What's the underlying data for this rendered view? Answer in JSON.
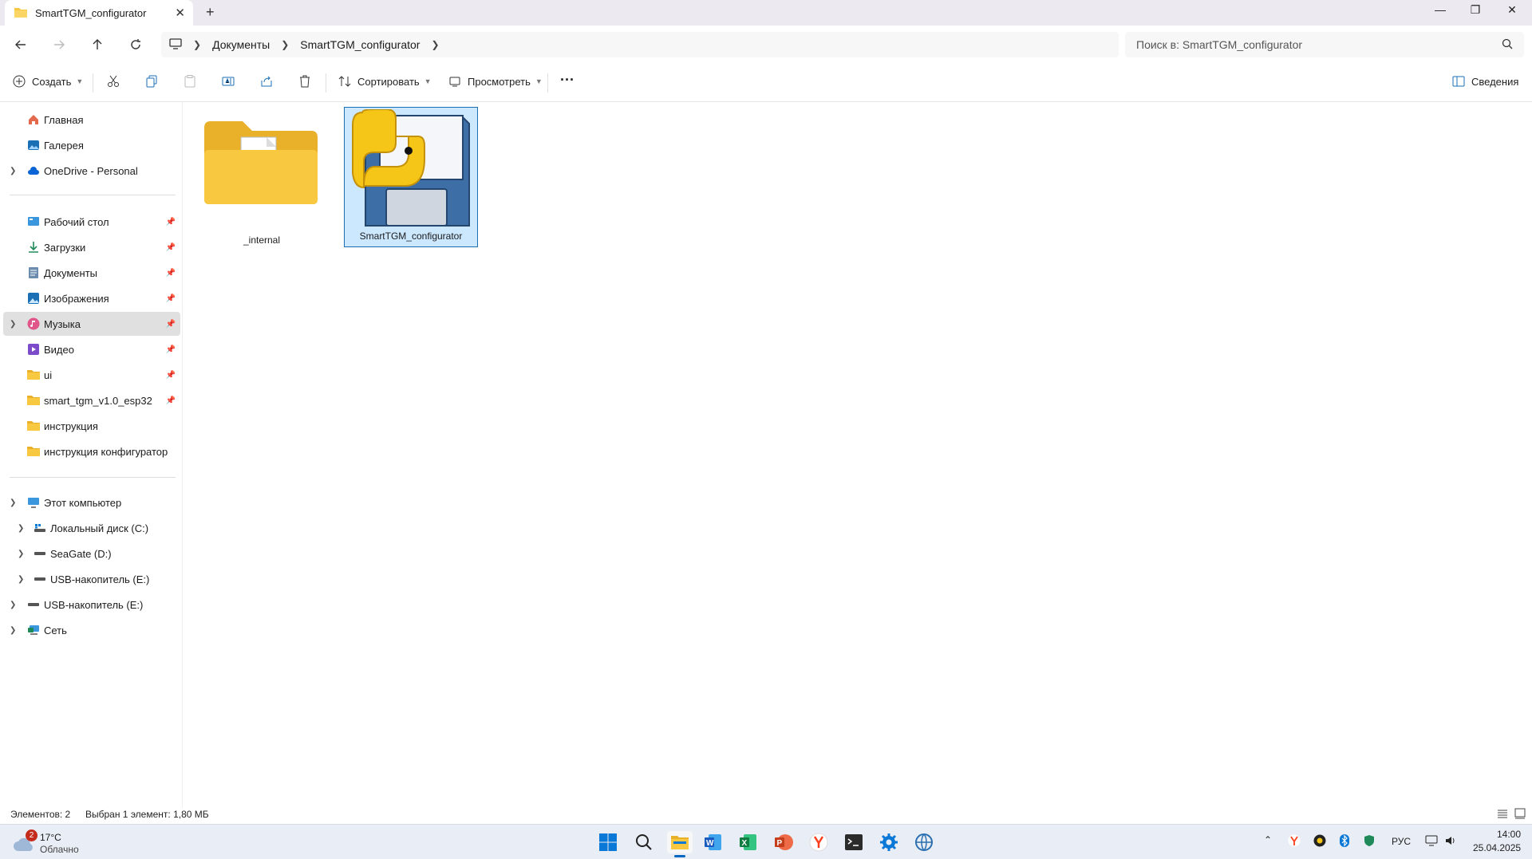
{
  "window": {
    "tab_title": "SmartTGM_configurator",
    "new_tab": "+",
    "minimize": "—",
    "maximize": "❐",
    "close": "✕"
  },
  "address": {
    "crumbs": [
      "Документы",
      "SmartTGM_configurator"
    ],
    "search_placeholder": "Поиск в: SmartTGM_configurator"
  },
  "toolbar": {
    "create": "Создать",
    "sort": "Сортировать",
    "view": "Просмотреть",
    "more": "···",
    "details": "Сведения"
  },
  "sidebar": {
    "top": [
      {
        "label": "Главная",
        "icon": "home-icon"
      },
      {
        "label": "Галерея",
        "icon": "gallery-icon"
      },
      {
        "label": "OneDrive - Personal",
        "icon": "cloud-icon"
      }
    ],
    "quick": [
      {
        "label": "Рабочий стол",
        "icon": "desktop-icon",
        "pinned": true
      },
      {
        "label": "Загрузки",
        "icon": "download-icon",
        "pinned": true
      },
      {
        "label": "Документы",
        "icon": "document-icon",
        "pinned": true
      },
      {
        "label": "Изображения",
        "icon": "pictures-icon",
        "pinned": true
      },
      {
        "label": "Музыка",
        "icon": "music-icon",
        "pinned": true,
        "selected": true
      },
      {
        "label": "Видео",
        "icon": "video-icon",
        "pinned": true
      },
      {
        "label": "ui",
        "icon": "folder-icon",
        "pinned": true
      },
      {
        "label": "smart_tgm_v1.0_esp32",
        "icon": "folder-icon",
        "pinned": true
      },
      {
        "label": "инструкция",
        "icon": "folder-icon",
        "pinned": false
      },
      {
        "label": "инструкция конфигуратор",
        "icon": "folder-icon",
        "pinned": false
      }
    ],
    "pc": [
      {
        "label": "Этот компьютер",
        "icon": "computer-icon"
      },
      {
        "label": "Локальный диск (C:)",
        "icon": "drive-icon"
      },
      {
        "label": "SeaGate (D:)",
        "icon": "drive-icon"
      },
      {
        "label": "USB-накопитель (E:)",
        "icon": "usb-drive-icon"
      },
      {
        "label": "USB-накопитель (E:)",
        "icon": "usb-drive-icon"
      },
      {
        "label": "Сеть",
        "icon": "network-icon"
      }
    ]
  },
  "files": [
    {
      "name": "_internal",
      "type": "folder"
    },
    {
      "name": "SmartTGM_configurator",
      "type": "python-exe",
      "selected": true
    }
  ],
  "status": {
    "count": "Элементов: 2",
    "selection": "Выбран 1 элемент: 1,80 МБ"
  },
  "taskbar": {
    "weather_temp": "17°C",
    "weather_desc": "Облачно",
    "weather_badge": "2",
    "lang": "РУС",
    "time": "14:00",
    "date": "25.04.2025"
  },
  "colors": {
    "accent": "#0067c0",
    "folder": "#f8c940",
    "selection_bg": "#cce8ff"
  }
}
